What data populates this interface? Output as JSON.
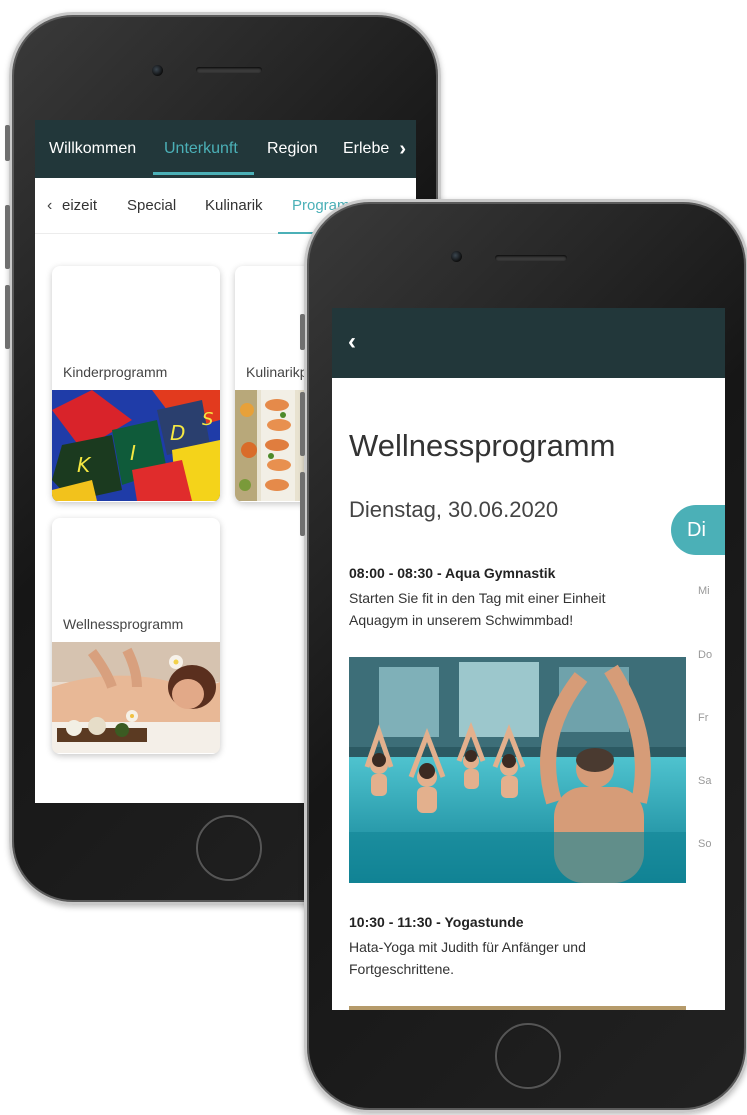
{
  "back_phone": {
    "top_nav": {
      "items": [
        "Willkommen",
        "Unterkunft",
        "Region",
        "Erlebe"
      ],
      "active": "Unterkunft",
      "next_icon": "chevron-right-icon"
    },
    "sub_nav": {
      "prev_icon": "chevron-left-icon",
      "items": [
        "eizeit",
        "Special",
        "Kulinarik",
        "Programm"
      ],
      "active": "Programm"
    },
    "cards": [
      {
        "label": "Kinderprogramm",
        "image": "kids-blocks-photo"
      },
      {
        "label": "Kulinarikp",
        "image": "buffet-photo"
      },
      {
        "label": "Wellnessprogramm",
        "image": "massage-photo"
      }
    ]
  },
  "front_phone": {
    "header": {
      "back_icon": "chevron-left-icon"
    },
    "title": "Wellnessprogramm",
    "date": "Dienstag, 30.06.2020",
    "days": {
      "active": "Di",
      "others": [
        "Mi",
        "Do",
        "Fr",
        "Sa",
        "So"
      ]
    },
    "events": [
      {
        "title": "08:00 - 08:30 - Aqua Gymnastik",
        "description": "Starten Sie fit in den Tag mit einer Einheit Aquagym in unserem Schwimmbad!",
        "image": "aqua-gym-photo"
      },
      {
        "title": "10:30 - 11:30 - Yogastunde",
        "description": "Hata-Yoga mit Judith für Anfänger und Fortgeschrittene."
      }
    ]
  },
  "colors": {
    "header_bg": "#22373a",
    "accent": "#4bb0b7"
  }
}
